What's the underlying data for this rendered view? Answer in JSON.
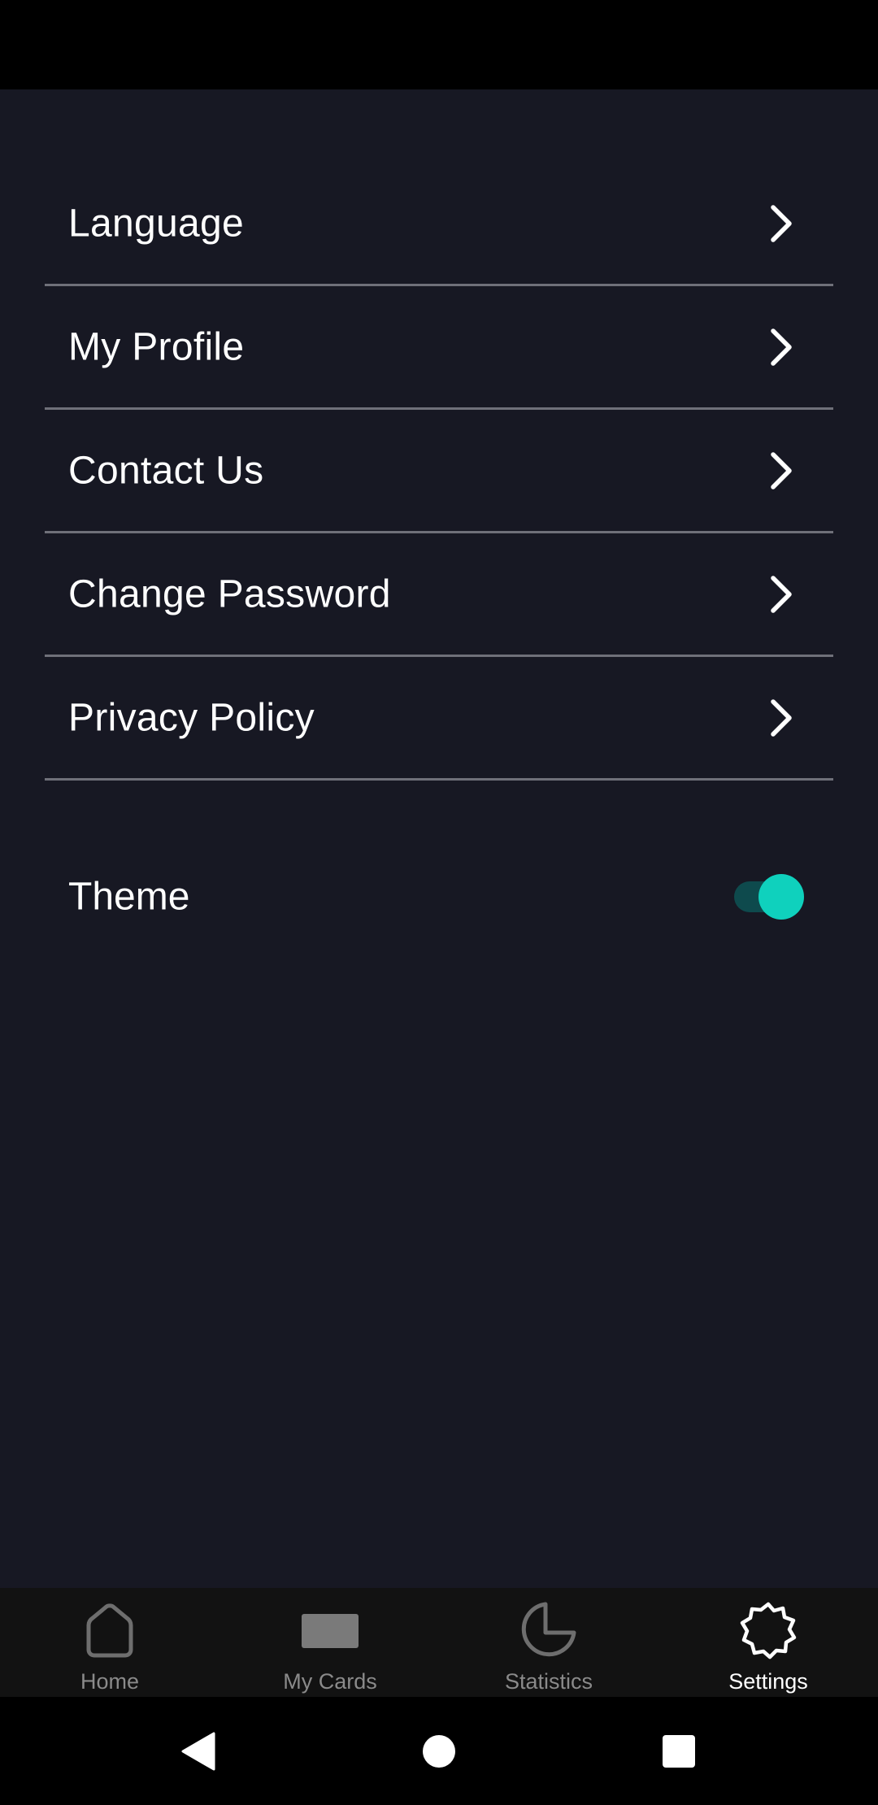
{
  "menu": {
    "items": [
      {
        "label": "Language"
      },
      {
        "label": "My Profile"
      },
      {
        "label": "Contact Us"
      },
      {
        "label": "Change Password"
      },
      {
        "label": "Privacy Policy"
      }
    ]
  },
  "theme": {
    "label": "Theme",
    "toggle_on": true,
    "toggle_knob_color": "#0fd1bd",
    "toggle_track_color": "#0e4a4d"
  },
  "bottom_nav": {
    "items": [
      {
        "label": "Home",
        "icon": "home-icon"
      },
      {
        "label": "My Cards",
        "icon": "card-icon"
      },
      {
        "label": "Statistics",
        "icon": "pie-chart-icon"
      },
      {
        "label": "Settings",
        "icon": "gear-icon"
      }
    ],
    "active": "Settings"
  },
  "colors": {
    "background": "#171823",
    "divider": "#6f7079",
    "text": "#ffffff",
    "nav_inactive": "#8a8a8a"
  }
}
